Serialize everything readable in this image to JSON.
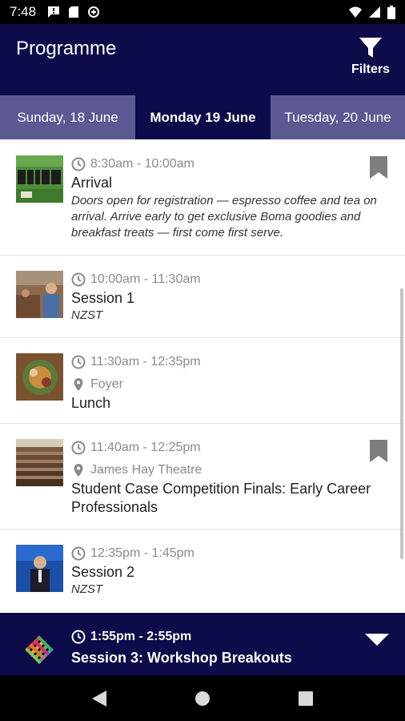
{
  "status_bar": {
    "time": "7:48"
  },
  "app_bar": {
    "title": "Programme",
    "filters_label": "Filters"
  },
  "tabs": [
    {
      "label": "Sunday, 18 June",
      "selected": false
    },
    {
      "label": "Monday 19 June",
      "selected": true
    },
    {
      "label": "Tuesday, 20 June",
      "selected": false
    }
  ],
  "events": [
    {
      "time": "8:30am - 10:00am",
      "title": "Arrival",
      "description": "Doors open for registration — espresso coffee and tea on arrival. Arrive early to get exclusive Boma goodies and breakfast treats — first come first serve.",
      "bookmarked": true
    },
    {
      "time": "10:00am - 11:30am",
      "title": "Session 1",
      "timezone": "NZST"
    },
    {
      "time": "11:30am - 12:35pm",
      "location": "Foyer",
      "title": "Lunch"
    },
    {
      "time": "11:40am - 12:25pm",
      "location": "James Hay Theatre",
      "title": "Student Case Competition Finals: Early Career Professionals",
      "bookmarked": true
    },
    {
      "time": "12:35pm - 1:45pm",
      "title": "Session 2",
      "timezone": "NZST"
    }
  ],
  "now_playing": {
    "time": "1:55pm - 2:55pm",
    "title": "Session 3: Workshop Breakouts"
  },
  "colors": {
    "primary": "#0e0b4a",
    "tab_inactive": "#5b5892",
    "muted": "#8a8a8a"
  }
}
